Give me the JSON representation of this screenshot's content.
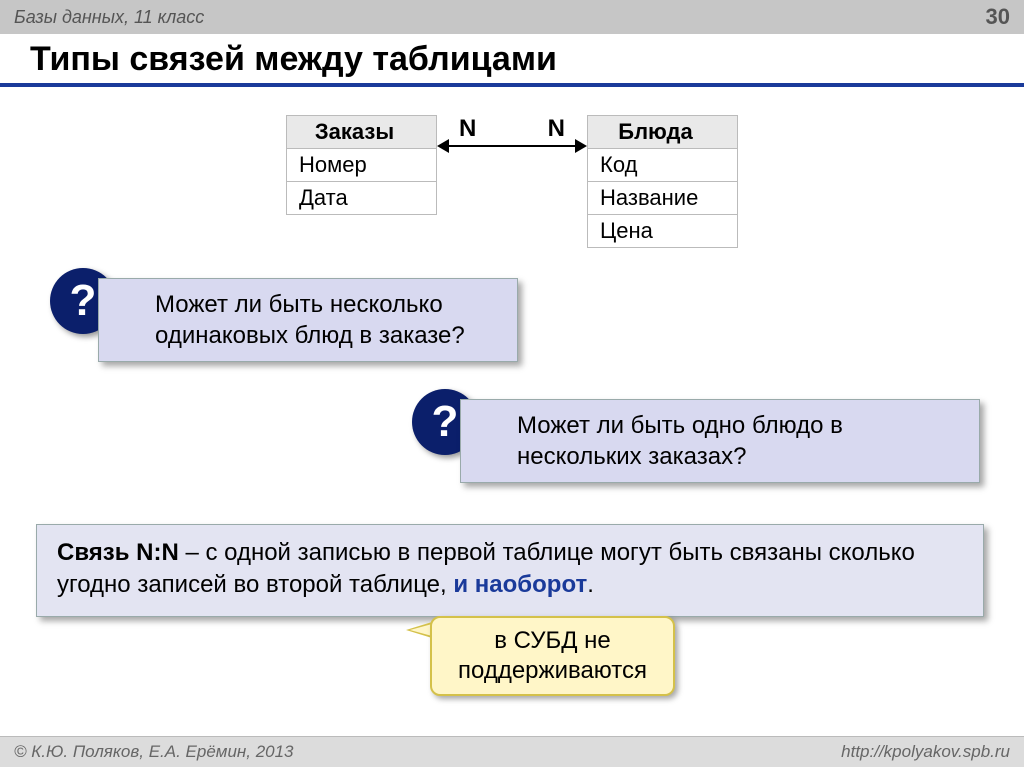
{
  "header": {
    "subject": "Базы данных, 11 класс",
    "page": "30"
  },
  "title": "Типы связей между таблицами",
  "tables": {
    "left": {
      "name": "Заказы",
      "fields": [
        "Номер",
        "Дата"
      ]
    },
    "right": {
      "name": "Блюда",
      "fields": [
        "Код",
        "Название",
        "Цена"
      ]
    },
    "relation": {
      "left_card": "N",
      "right_card": "N"
    }
  },
  "questions": {
    "q1": "Может ли быть несколько одинаковых блюд в заказе?",
    "q2": "Может ли быть одно блюдо в нескольких заказах?",
    "badge": "?"
  },
  "definition": {
    "term": "Связь N:N",
    "body_pre": " – с одной записью в первой таблице могут быть связаны сколько угодно записей во второй таблице, ",
    "accent": "и наоборот",
    "dot": "."
  },
  "callout": {
    "line1": "в СУБД не",
    "line2": "поддерживаются"
  },
  "footer": {
    "left": "© К.Ю. Поляков, Е.А. Ерёмин, 2013",
    "right": "http://kpolyakov.spb.ru"
  }
}
